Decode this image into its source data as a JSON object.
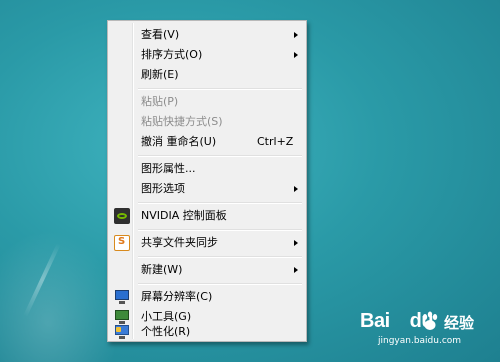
{
  "desktop": {
    "context_menu": {
      "items": [
        {
          "label": "查看(V)",
          "submenu": true,
          "disabled": false
        },
        {
          "label": "排序方式(O)",
          "submenu": true,
          "disabled": false
        },
        {
          "label": "刷新(E)",
          "submenu": false,
          "disabled": false
        },
        {
          "label": "粘贴(P)",
          "submenu": false,
          "disabled": true
        },
        {
          "label": "粘贴快捷方式(S)",
          "submenu": false,
          "disabled": true
        },
        {
          "label": "撤消 重命名(U)",
          "shortcut": "Ctrl+Z",
          "submenu": false,
          "disabled": false
        },
        {
          "label": "图形属性...",
          "submenu": false,
          "disabled": false
        },
        {
          "label": "图形选项",
          "submenu": true,
          "disabled": false
        },
        {
          "label": "NVIDIA 控制面板",
          "icon": "nvidia-icon",
          "submenu": false,
          "disabled": false
        },
        {
          "label": "共享文件夹同步",
          "icon": "share-sync-icon",
          "submenu": true,
          "disabled": false
        },
        {
          "label": "新建(W)",
          "submenu": true,
          "disabled": false
        },
        {
          "label": "屏幕分辨率(C)",
          "icon": "monitor-icon",
          "submenu": false,
          "disabled": false
        },
        {
          "label": "小工具(G)",
          "icon": "gadget-icon",
          "submenu": false,
          "disabled": false
        },
        {
          "label": "个性化(R)",
          "icon": "personalize-icon",
          "submenu": false,
          "disabled": false
        }
      ]
    }
  },
  "watermark": {
    "brand": "Bai",
    "brand_suffix": "du",
    "product": "经验",
    "url": "jingyan.baidu.com"
  },
  "colors": {
    "menu_bg": "#f0f0f0",
    "disabled_text": "#8c8c8c",
    "desktop_teal": "#2a9aa7"
  }
}
